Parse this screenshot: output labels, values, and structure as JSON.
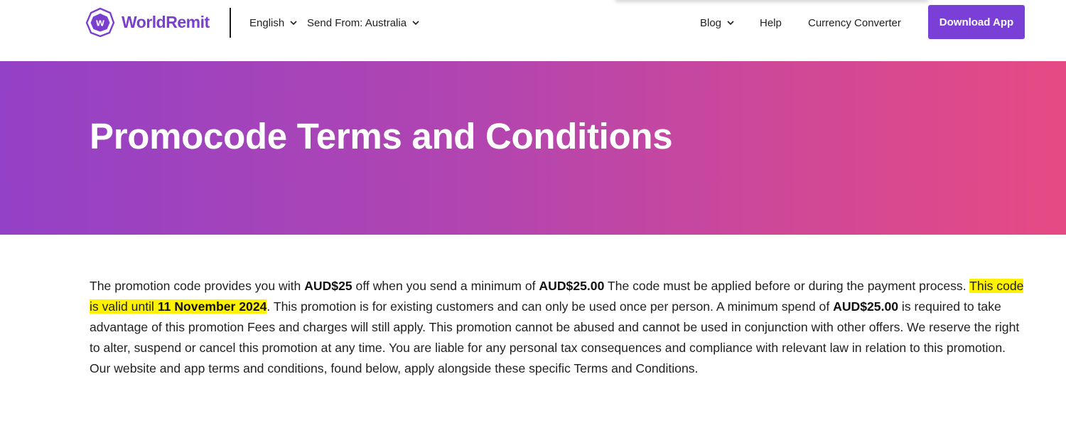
{
  "header": {
    "brand": "WorldRemit",
    "language": "English",
    "send_from": "Send From: Australia",
    "nav": {
      "blog": "Blog",
      "help": "Help",
      "currency_converter": "Currency Converter"
    },
    "download_button": "Download App"
  },
  "hero": {
    "title": "Promocode Terms and Conditions"
  },
  "terms": {
    "p1": "The promotion code provides you with ",
    "discount": "AUD$25",
    "p2": " off when you send a minimum of ",
    "minimum": "AUD$25.00",
    "p3": " The code must be applied before or during the payment process. ",
    "validity_text": "This code is valid until ",
    "valid_date": "11 November 2024",
    "p4": ". This promotion is for existing customers and can only be used once per person. A minimum spend of ",
    "minimum_spend": "AUD$25.00",
    "p5": " is required to take advantage of this promotion Fees and charges will still apply. This promotion cannot be abused and cannot be used in conjunction with other offers. We reserve the right to alter, suspend or cancel this promotion at any time. You are liable for any personal tax consequences and compliance with relevant law in relation to this promotion. Our website and app terms and conditions, found below, apply alongside these specific Terms and Conditions."
  },
  "icons": {
    "logo": "worldremit-logo-icon",
    "chevron": "chevron-down-icon"
  },
  "colors": {
    "brand": "#7a3fd6",
    "hero_gradient_start": "#9341c6",
    "hero_gradient_end": "#e64a84",
    "highlight": "#fff200"
  }
}
